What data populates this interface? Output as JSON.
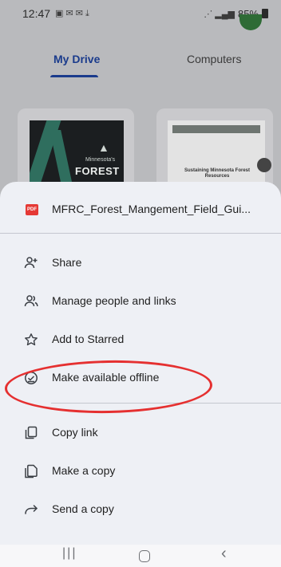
{
  "status_bar": {
    "time": "12:47",
    "battery": "85%"
  },
  "drive": {
    "tabs": [
      {
        "label": "My Drive",
        "selected": true
      },
      {
        "label": "Computers",
        "selected": false
      }
    ],
    "thumbnails": [
      {
        "caption_small": "Minnesota's",
        "caption_large": "FOREST"
      },
      {
        "title": "Sustaining Minnesota Forest Resources"
      }
    ]
  },
  "sheet": {
    "file_type_badge": "PDF",
    "file_name": "MFRC_Forest_Mangement_Field_Gui...",
    "menu_items": [
      {
        "label": "Share",
        "icon": "person-add-icon"
      },
      {
        "label": "Manage people and links",
        "icon": "people-icon"
      },
      {
        "label": "Add to Starred",
        "icon": "star-outline-icon"
      },
      {
        "label": "Make available offline",
        "icon": "offline-check-icon"
      },
      {
        "label": "Copy link",
        "icon": "copy-link-icon"
      },
      {
        "label": "Make a copy",
        "icon": "file-copy-icon"
      },
      {
        "label": "Send a copy",
        "icon": "forward-arrow-icon"
      }
    ]
  },
  "colors": {
    "accent_tab": "#1a3b8c",
    "pdf_badge": "#e53935",
    "annotation": "#e53030",
    "sheet_bg": "#eef0f5"
  }
}
